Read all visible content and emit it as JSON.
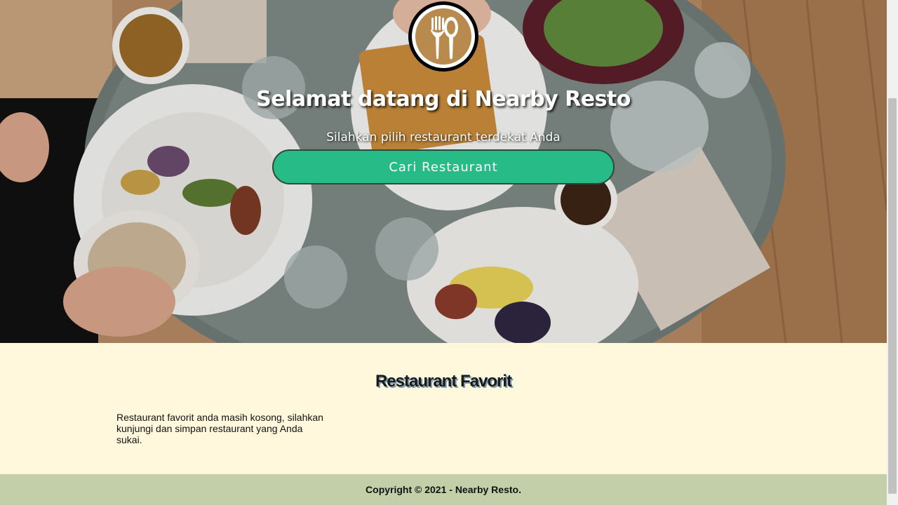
{
  "hero": {
    "title": "Selamat datang di Nearby Resto",
    "subtitle": "Silahkan pilih restaurant terdekat Anda",
    "cta_label": "Cari Restaurant",
    "logo_icon": "fork-spoon-icon",
    "background": "food-table-photo"
  },
  "favorites": {
    "title": "Restaurant Favorit",
    "empty_message": "Restaurant favorit anda masih kosong, silahkan kunjungi dan simpan restaurant yang Anda sukai."
  },
  "footer": {
    "copyright": "Copyright © 2021 - Nearby Resto."
  },
  "colors": {
    "accent": "#26bb87",
    "page_bg": "#fff8dc",
    "footer_bg": "#c3cfa9"
  }
}
